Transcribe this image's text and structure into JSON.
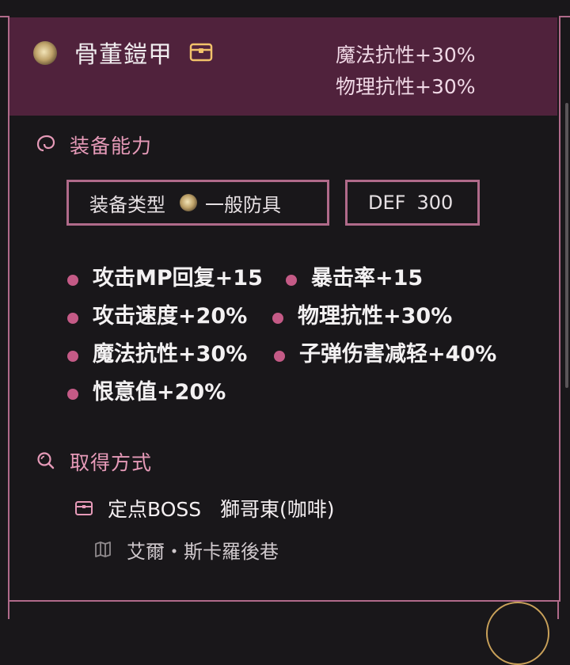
{
  "item": {
    "name": "骨董鎧甲",
    "stats": [
      "魔法抗性+30%",
      "物理抗性+30%"
    ]
  },
  "ability": {
    "title": "装备能力",
    "type_label": "装备类型",
    "type_value": "一般防具",
    "def_label": "DEF",
    "def_value": "300",
    "effects": [
      "攻击MP回复+15",
      "暴击率+15",
      "攻击速度+20%",
      "物理抗性+30%",
      "魔法抗性+30%",
      "子弹伤害减轻+40%",
      "恨意值+20%"
    ]
  },
  "acquire": {
    "title": "取得方式",
    "source_type": "定点BOSS",
    "source_name": "獅哥東(咖啡)",
    "location": "艾爾・斯卡羅後巷"
  },
  "colors": {
    "accent": "#b06a8a",
    "header_bg": "#50223c",
    "section_title": "#e69ab8",
    "dot": "#c45a86"
  },
  "icons": [
    "armor-item-icon",
    "chest-icon",
    "swirl-icon",
    "search-icon",
    "map-icon"
  ]
}
